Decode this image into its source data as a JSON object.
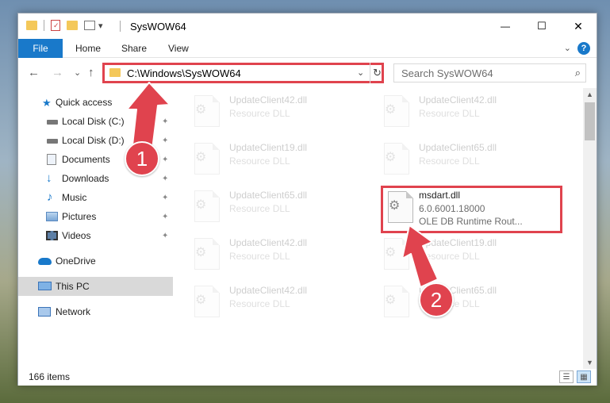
{
  "window": {
    "title": "SysWOW64"
  },
  "quick_access": {
    "dropdown": "▾"
  },
  "window_buttons": {
    "minimize": "—",
    "maximize": "☐",
    "close": "✕"
  },
  "ribbon": {
    "tabs": [
      "File",
      "Home",
      "Share",
      "View"
    ],
    "help": "?"
  },
  "nav": {
    "back": "←",
    "forward": "→",
    "recent": "⌄",
    "up": "↑",
    "address": "C:\\Windows\\SysWOW64",
    "address_dropdown": "⌄",
    "refresh": "↻",
    "search_placeholder": "Search SysWOW64",
    "search_icon": "⌕"
  },
  "sidebar": {
    "items": [
      {
        "label": "Quick access",
        "icon": "star-icon",
        "pinned": false
      },
      {
        "label": "Local Disk (C:)",
        "icon": "drive-icon",
        "pinned": true
      },
      {
        "label": "Local Disk (D:)",
        "icon": "drive-icon",
        "pinned": true
      },
      {
        "label": "Documents",
        "icon": "documents-icon",
        "pinned": true
      },
      {
        "label": "Downloads",
        "icon": "downloads-icon",
        "pinned": true
      },
      {
        "label": "Music",
        "icon": "music-icon",
        "pinned": true
      },
      {
        "label": "Pictures",
        "icon": "pictures-icon",
        "pinned": true
      },
      {
        "label": "Videos",
        "icon": "videos-icon",
        "pinned": true
      },
      {
        "label": "OneDrive",
        "icon": "cloud-icon",
        "pinned": false
      },
      {
        "label": "This PC",
        "icon": "computer-icon",
        "pinned": false,
        "selected": true
      },
      {
        "label": "Network",
        "icon": "network-icon",
        "pinned": false
      }
    ],
    "pin_glyph": "📌"
  },
  "files": {
    "faded_name_1": "UpdateClient42.dll",
    "faded_name_2": "UpdateClient42.dll",
    "faded_name_3": "UpdateClient19.dll",
    "faded_name_4": "UpdateClient65.dll",
    "faded_name_5": "UpdateClient65.dll",
    "faded_name_6": "UpdateClient42.dll",
    "faded_name_7": "UpdateClient19.dll",
    "faded_name_8": "UpdateClient42.dll",
    "faded_name_9": "UpdateClient65.dll",
    "faded_sub": "Resource DLL",
    "main": {
      "name": "msdart.dll",
      "version": "6.0.6001.18000",
      "description": "OLE DB Runtime Rout..."
    }
  },
  "status": {
    "count": "166 items"
  },
  "annotations": {
    "step1": "1",
    "step2": "2"
  },
  "colors": {
    "accent": "#1979ca",
    "highlight": "#e0434e",
    "folder": "#f4c85a"
  }
}
